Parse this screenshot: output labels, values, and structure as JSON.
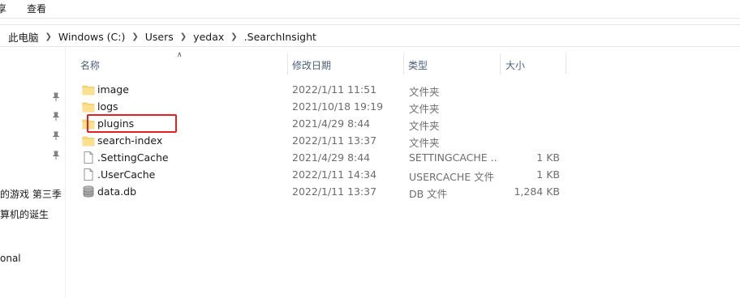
{
  "ribbon": {
    "left_label": "享",
    "view_label": "查看"
  },
  "breadcrumb": [
    "此电脑",
    "Windows (C:)",
    "Users",
    "yedax",
    ".SearchInsight"
  ],
  "nav": {
    "item_game": "的游戏 第三季 (",
    "item_computer": "算机的诞生",
    "item_onal": "onal"
  },
  "columns": {
    "name": "名称",
    "date": "修改日期",
    "type": "类型",
    "size": "大小"
  },
  "files": [
    {
      "name": "image",
      "date": "2022/1/11 11:51",
      "type": "文件夹",
      "size": "",
      "icon": "folder-icon"
    },
    {
      "name": "logs",
      "date": "2021/10/18 19:19",
      "type": "文件夹",
      "size": "",
      "icon": "folder-icon"
    },
    {
      "name": "plugins",
      "date": "2021/4/29 8:44",
      "type": "文件夹",
      "size": "",
      "icon": "folder-icon"
    },
    {
      "name": "search-index",
      "date": "2022/1/11 13:37",
      "type": "文件夹",
      "size": "",
      "icon": "folder-icon"
    },
    {
      "name": ".SettingCache",
      "date": "2021/4/29 8:44",
      "type": "SETTINGCACHE ...",
      "size": "1 KB",
      "icon": "file-icon"
    },
    {
      "name": ".UserCache",
      "date": "2022/1/11 14:34",
      "type": "USERCACHE 文件",
      "size": "1 KB",
      "icon": "file-icon"
    },
    {
      "name": "data.db",
      "date": "2022/1/11 13:37",
      "type": "DB 文件",
      "size": "1,284 KB",
      "icon": "database-icon"
    }
  ],
  "colors": {
    "highlight": "#e62020",
    "folder": "#f8d775",
    "header_text": "#4c607a"
  }
}
